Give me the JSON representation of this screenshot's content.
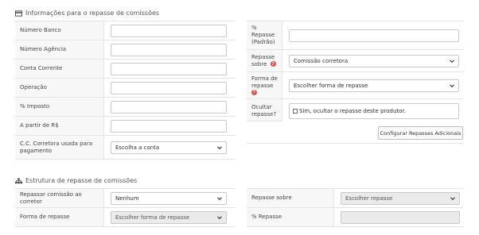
{
  "section1": {
    "title": "Informações para o repasse de comissões",
    "left_fields": [
      {
        "label": "Número Banco",
        "value": ""
      },
      {
        "label": "Número Agência",
        "value": ""
      },
      {
        "label": "Conta Corrente",
        "value": ""
      },
      {
        "label": "Operação",
        "value": ""
      },
      {
        "label": "% Imposto",
        "value": ""
      },
      {
        "label": "A partir de R$",
        "value": ""
      }
    ],
    "cc_corretora": {
      "label": "C.C. Corretora usada para pagamento",
      "selected": "Escolha a conta"
    },
    "percent_repasse": {
      "label": "% Repasse (Padrão)",
      "value": ""
    },
    "repasse_sobre": {
      "label": "Repasse sobre",
      "selected": "Comissão corretora"
    },
    "forma_repasse": {
      "label": "Forma de repasse",
      "selected": "Escolher forma de repasse"
    },
    "ocultar_repasse": {
      "label": "Ocultar repasse?",
      "checkbox_label": "Sim, ocultar o repasse deste produtor."
    },
    "config_button": "Configurar Repasses Adicionais"
  },
  "section2": {
    "title": "Estrutura de repasse de comissões",
    "repassar_comissao": {
      "label": "Repassar comissão ao corretor",
      "selected": "Nenhum"
    },
    "forma_repasse": {
      "label": "Forma de repasse",
      "selected": "Escolher forma de repasse"
    },
    "repasse_sobre": {
      "label": "Repasse sobre",
      "selected": "Escolher repasse"
    },
    "percent_repasse": {
      "label": "% Repasse",
      "value": ""
    }
  },
  "icons": {
    "section1_icon": "credit-card-icon",
    "section2_icon": "sitemap-icon",
    "help": "question-icon"
  },
  "colors": {
    "help_badge": "#d9534f",
    "label_bg": "#f7f7f7",
    "disabled_bg": "#ebebeb"
  }
}
